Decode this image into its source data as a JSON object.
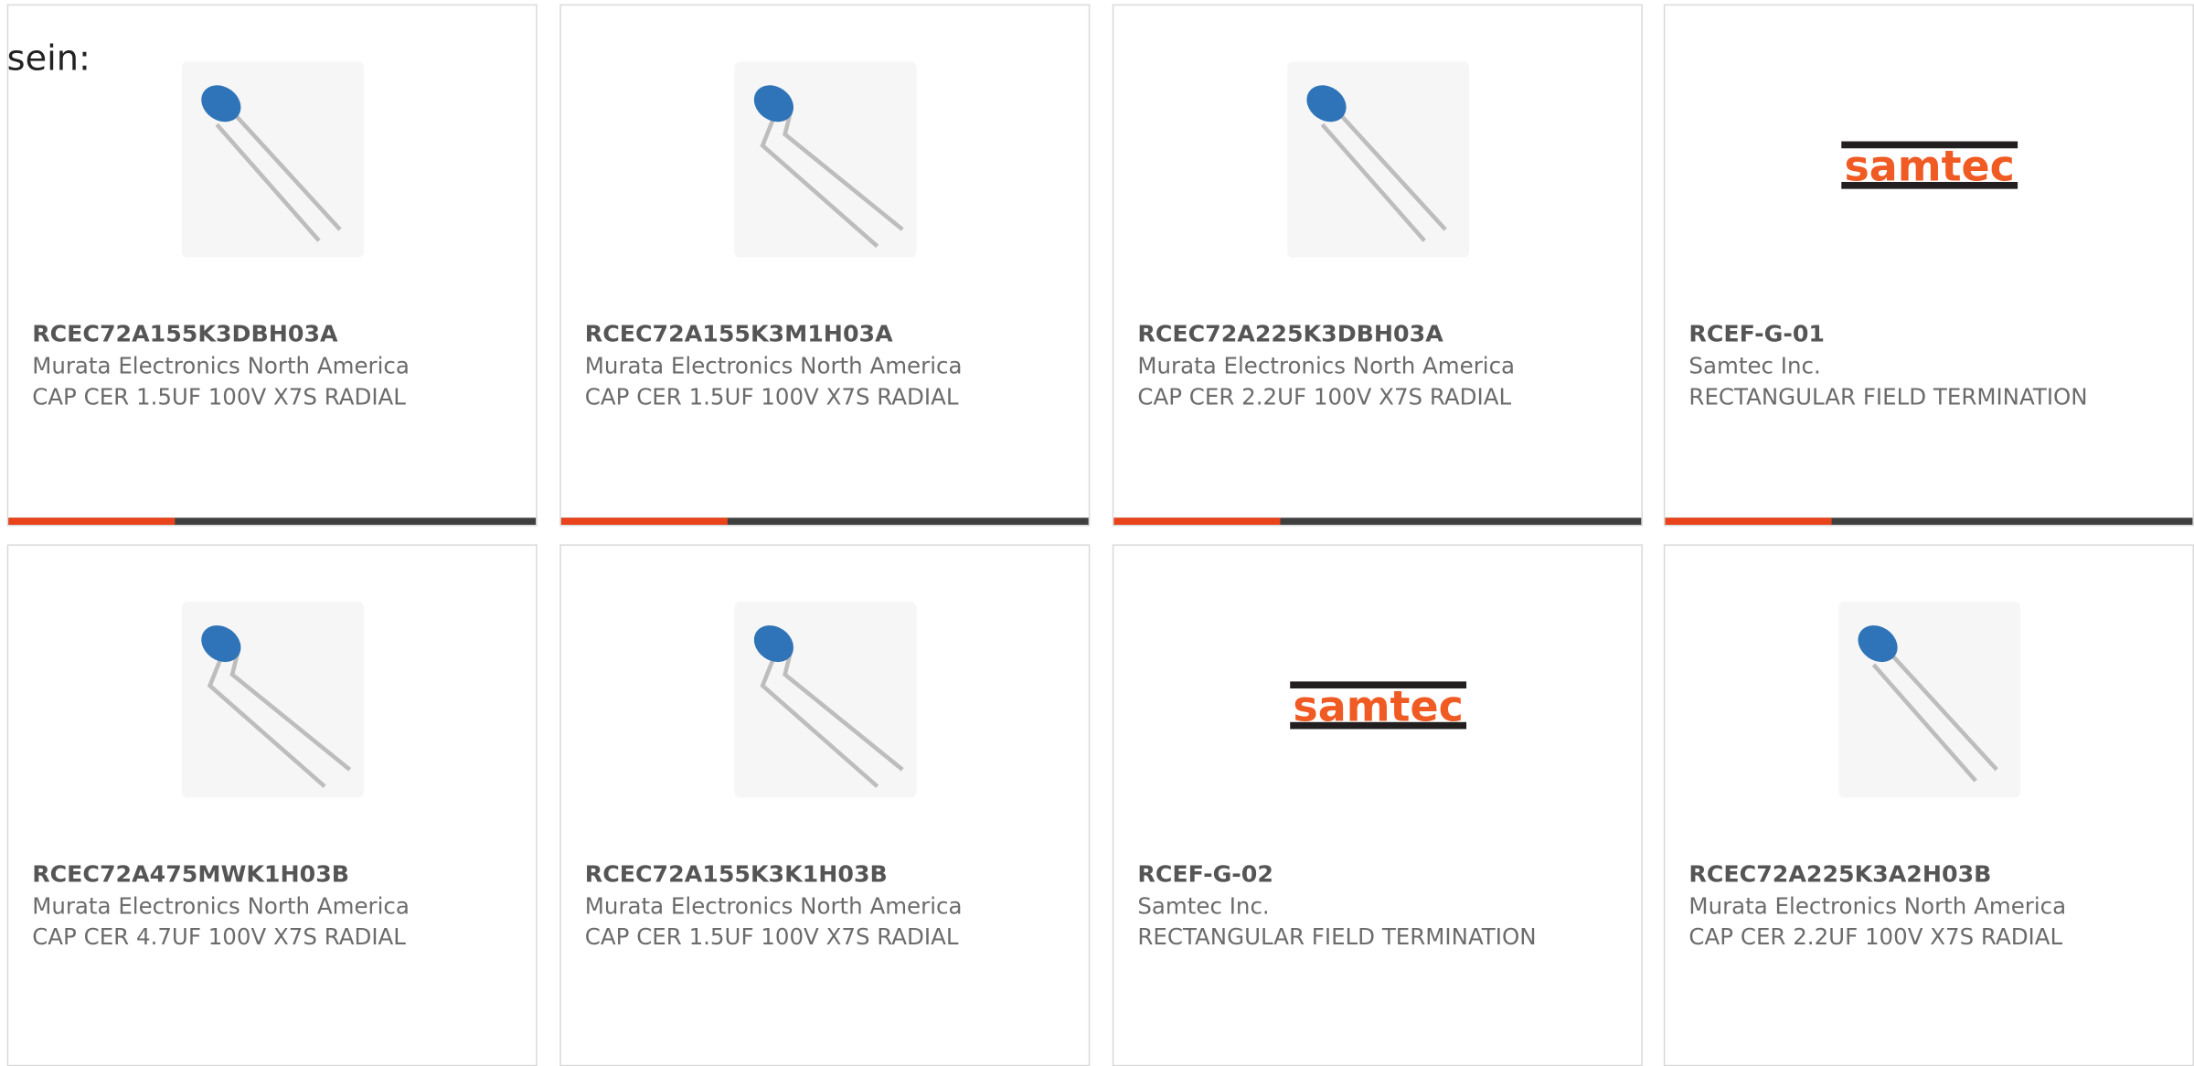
{
  "intro_text": "sein:",
  "colors": {
    "accent": "#e8431a",
    "bar": "#3f3f3f",
    "capacitor_blue": "#2f74b8",
    "samtec_orange": "#f05a23"
  },
  "products": [
    {
      "part": "RCEC72A155K3DBH03A",
      "maker": "Murata Electronics North America",
      "desc": "CAP CER 1.5UF 100V X7S RADIAL",
      "image": "capacitor-icon"
    },
    {
      "part": "RCEC72A155K3M1H03A",
      "maker": "Murata Electronics North America",
      "desc": "CAP CER 1.5UF 100V X7S RADIAL",
      "image": "capacitor-kinked-icon"
    },
    {
      "part": "RCEC72A225K3DBH03A",
      "maker": "Murata Electronics North America",
      "desc": "CAP CER 2.2UF 100V X7S RADIAL",
      "image": "capacitor-icon"
    },
    {
      "part": "RCEF-G-01",
      "maker": "Samtec Inc.",
      "desc": "RECTANGULAR FIELD TERMINATION",
      "image": "samtec-logo"
    },
    {
      "part": "RCEC72A475MWK1H03B",
      "maker": "Murata Electronics North America",
      "desc": "CAP CER 4.7UF 100V X7S RADIAL",
      "image": "capacitor-kinked-icon"
    },
    {
      "part": "RCEC72A155K3K1H03B",
      "maker": "Murata Electronics North America",
      "desc": "CAP CER 1.5UF 100V X7S RADIAL",
      "image": "capacitor-kinked-icon"
    },
    {
      "part": "RCEF-G-02",
      "maker": "Samtec Inc.",
      "desc": "RECTANGULAR FIELD TERMINATION",
      "image": "samtec-logo"
    },
    {
      "part": "RCEC72A225K3A2H03B",
      "maker": "Murata Electronics North America",
      "desc": "CAP CER 2.2UF 100V X7S RADIAL",
      "image": "capacitor-icon"
    }
  ],
  "logo_text": "samtec"
}
